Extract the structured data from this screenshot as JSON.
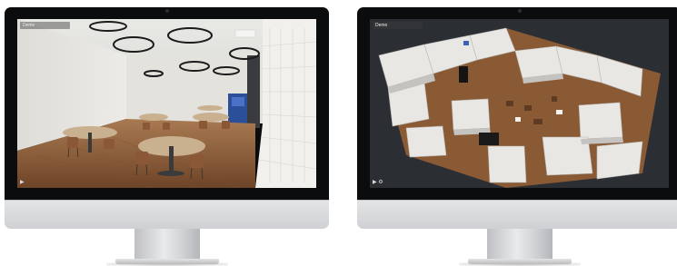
{
  "monitors": [
    {
      "name": "left-monitor",
      "screen_kind": "interior-photo",
      "url_chip": "Demo",
      "scene": "cafeteria-interior-3d-tour"
    },
    {
      "name": "right-monitor",
      "screen_kind": "dollhouse-3d-model",
      "url_chip": "Demo",
      "scene": "building-dollhouse-view"
    }
  ],
  "colors": {
    "bezel": "#0b0c0e",
    "chin": "#dcdde0",
    "stand": "#d0d1d4",
    "floor": "#8a5a35",
    "wall": "#e6e5e0",
    "dark_bg": "#2b2e33"
  },
  "icons": {
    "play": "play-icon",
    "settings": "gear-icon",
    "fullscreen": "fullscreen-icon"
  }
}
